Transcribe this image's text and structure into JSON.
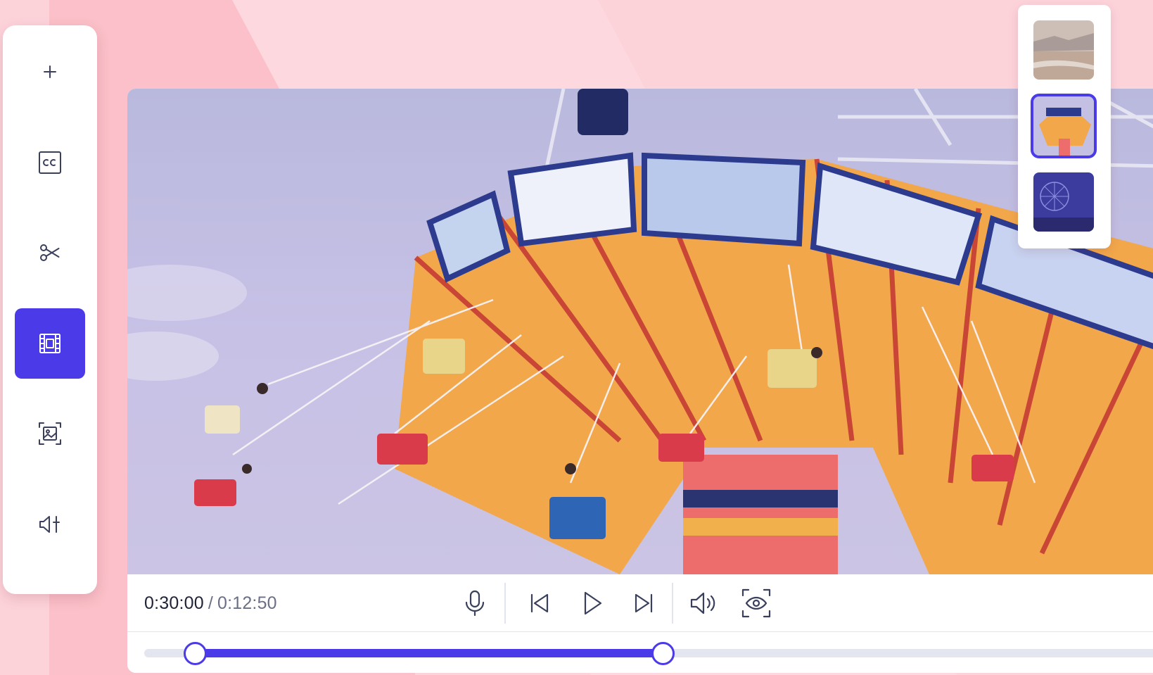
{
  "player": {
    "current_time": "0:30:00",
    "separator": "/",
    "total_time": "0:12:50",
    "trim": {
      "start_fraction": 0.05,
      "end_fraction": 0.51
    }
  },
  "sidebar": {
    "items": [
      {
        "icon": "plus-icon",
        "active": false
      },
      {
        "icon": "closed-captions-icon",
        "active": false
      },
      {
        "icon": "scissors-icon",
        "active": false
      },
      {
        "icon": "film-strip-icon",
        "active": true
      },
      {
        "icon": "image-frame-icon",
        "active": false
      },
      {
        "icon": "audio-adjust-icon",
        "active": false
      }
    ]
  },
  "controls": {
    "icons": [
      "microphone-icon",
      "skip-back-icon",
      "play-icon",
      "skip-forward-icon",
      "volume-icon",
      "preview-eye-icon"
    ]
  },
  "thumbnails": {
    "items": [
      {
        "name": "beach-thumbnail",
        "selected": false
      },
      {
        "name": "carousel-thumbnail",
        "selected": true
      },
      {
        "name": "ferris-wheel-night-thumbnail",
        "selected": false
      }
    ]
  },
  "colors": {
    "accent": "#4a3ae8",
    "background": "#fdd3da"
  }
}
